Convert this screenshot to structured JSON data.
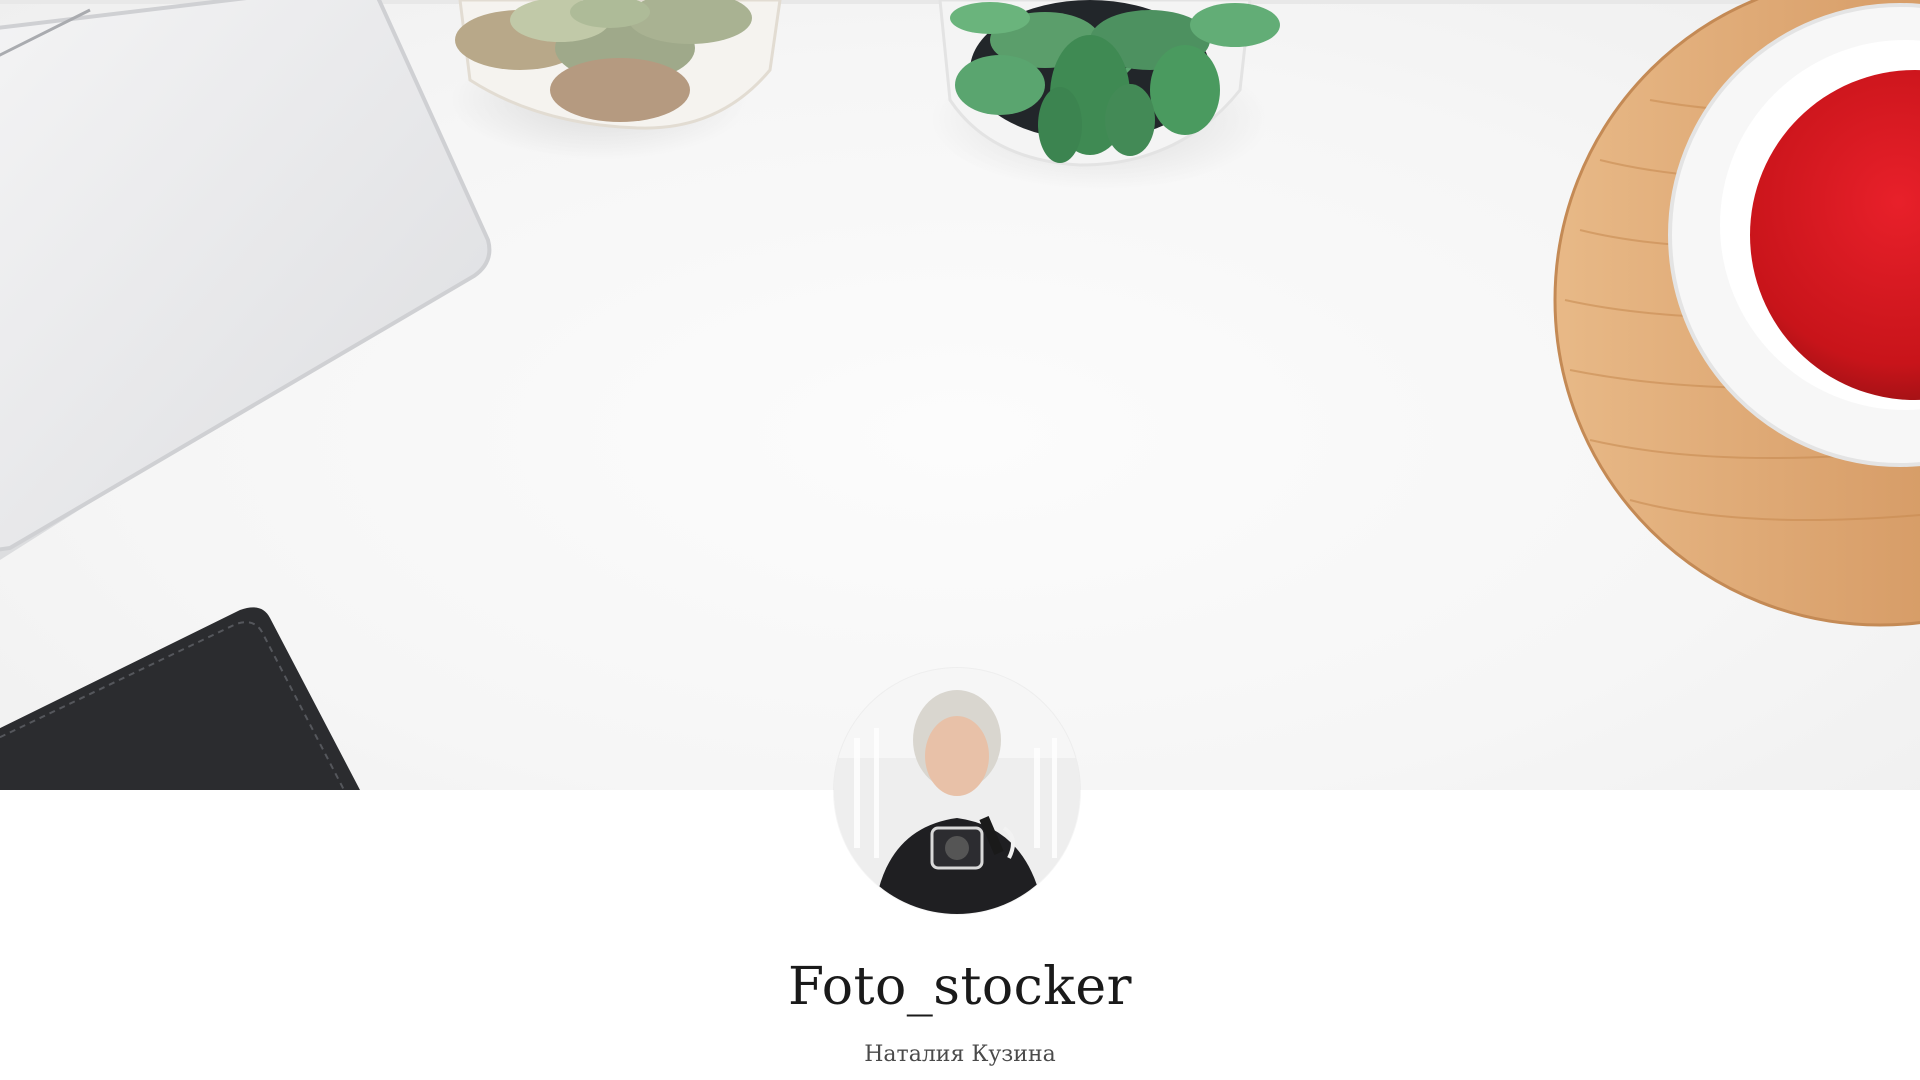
{
  "profile": {
    "username": "Foto_stocker",
    "full_name": "Наталия Кузина",
    "avatar_alt": "avatar"
  },
  "cover": {
    "objects": [
      "laptop",
      "succulent-pot",
      "succulent-pot",
      "wooden-coaster",
      "tea-cup",
      "notebook"
    ]
  },
  "colors": {
    "background": "#ffffff",
    "cover_background": "#f6f6f6",
    "name_text": "#1a1a1a",
    "subtitle_text": "#4a4a4a",
    "tea": "#c8141a",
    "wood": "#d9a06b"
  }
}
